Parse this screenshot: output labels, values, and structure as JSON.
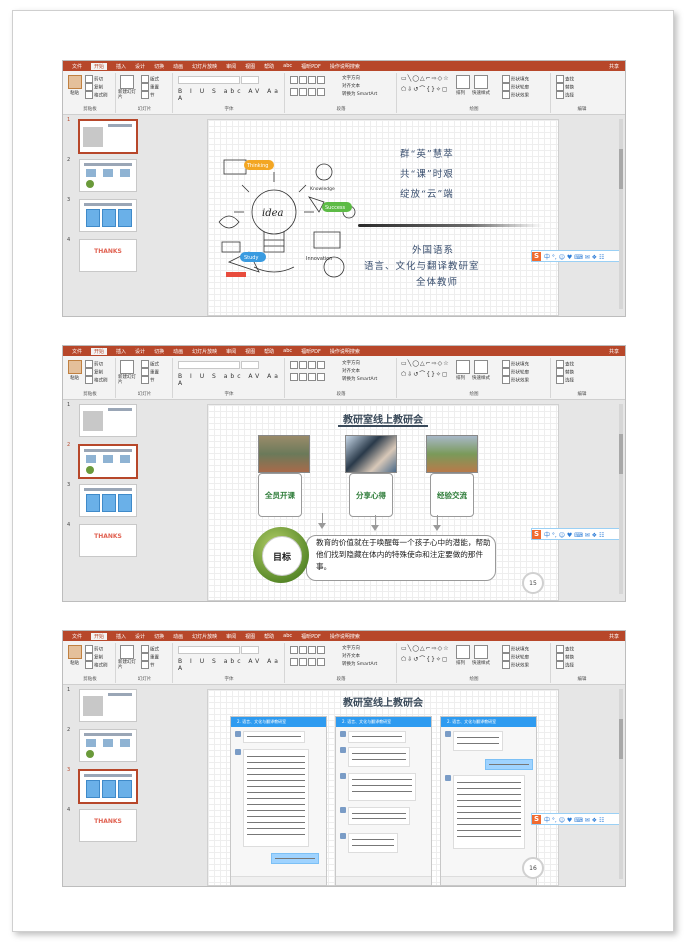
{
  "menu": {
    "tabs": [
      "文件",
      "开始",
      "插入",
      "设计",
      "切换",
      "动画",
      "幻灯片放映",
      "审阅",
      "视图",
      "帮助",
      "abc",
      "福昕PDF",
      "操作说明搜索"
    ],
    "share": "共享",
    "active_tab": "开始"
  },
  "ribbon": {
    "paste": "粘贴",
    "cut": "剪切",
    "copy": "复制",
    "format_painter": "格式刷",
    "new_slide": "新建幻灯片",
    "layout": "版式",
    "reset": "重置",
    "section": "节",
    "group_clipboard": "剪贴板",
    "group_slides": "幻灯片",
    "group_font": "字体",
    "group_paragraph": "段落",
    "group_drawing": "绘图",
    "group_editing": "编辑",
    "text_direction": "文字方向",
    "align_text": "对齐文本",
    "smartart": "转换为 SmartArt",
    "arrange": "排列",
    "quick_styles": "快速样式",
    "shape_fill": "形状填充",
    "shape_outline": "形状轮廓",
    "shape_effects": "形状效果",
    "find": "查找",
    "replace": "替换",
    "select": "选择",
    "format_buttons": "B I U S abc AV Aa A"
  },
  "thumbs": {
    "numbers": [
      "1",
      "2",
      "3",
      "4"
    ],
    "thanks": "THANKS"
  },
  "sogou": {
    "s": "S",
    "items": "中 °, ☺ ♥ ⌨ ✉ ❖ ☷"
  },
  "slide1": {
    "line1": "群“英”慧萃",
    "line2": "共“课”时艰",
    "line3": "绽放“云”端",
    "line4": "外国语系",
    "line5": "语言、文化与翻译教研室",
    "line6": "全体教师",
    "doodle": {
      "idea": "idea",
      "thinking": "Thinking",
      "study": "Study",
      "innovation": "Innovation",
      "successful": "Success",
      "knowledge": "Knowledge"
    }
  },
  "slide2": {
    "title": "教研室线上教研会",
    "box1": "全员开课",
    "box2": "分享心得",
    "box3": "经验交流",
    "goal_label": "目标",
    "goal_text": "教育的价值就在于唤醒每一个孩子心中的潜能，帮助他们找到隐藏在体内的特殊使命和注定要做的那件事。",
    "page_number": "15"
  },
  "slide3": {
    "title": "教研室线上教研会",
    "chat_header": "2. 语言、文化与翻译教研室",
    "page_number": "16"
  },
  "colors": {
    "ppt_red": "#b7472a",
    "slide_title": "#3a4a5a",
    "green_text": "#2f7d3a",
    "chat_blue": "#2e9bf0"
  }
}
